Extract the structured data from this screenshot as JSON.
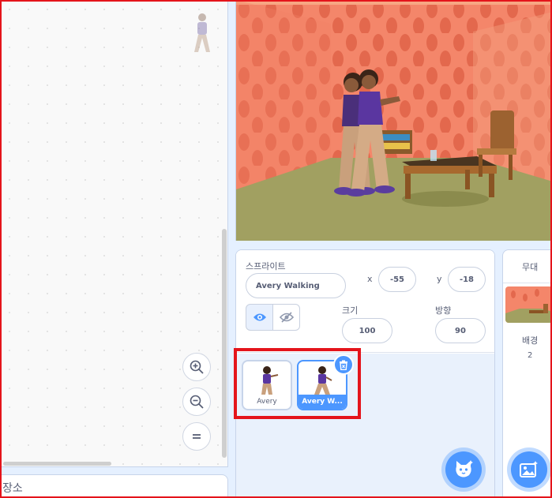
{
  "code_area": {
    "backpack_label": "장소"
  },
  "sprite_info": {
    "sprite_label": "스프라이트",
    "sprite_name": "Avery Walking",
    "x_label": "x",
    "x_value": "-55",
    "y_label": "y",
    "y_value": "-18",
    "size_label": "크기",
    "size_value": "100",
    "direction_label": "방향",
    "direction_value": "90"
  },
  "sprites": [
    {
      "name": "Avery",
      "selected": false
    },
    {
      "name": "Avery W...",
      "selected": true
    }
  ],
  "stage_target": {
    "header": "무대",
    "backdrop_label": "배경",
    "backdrop_count": "2"
  },
  "colors": {
    "accent": "#4c97ff",
    "highlight": "#e4141b",
    "wall": "#f4866a",
    "floor": "#a1a061"
  }
}
